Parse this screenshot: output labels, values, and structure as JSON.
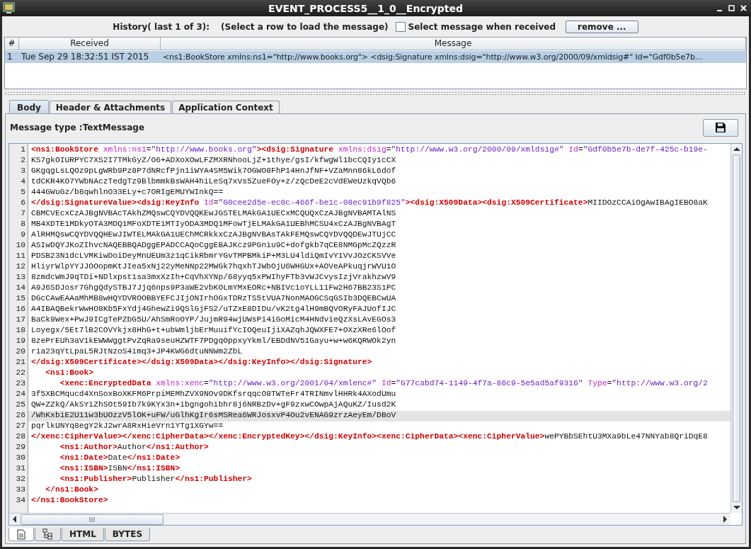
{
  "window": {
    "title": "EVENT_PROCESS5__1_0__Encrypted"
  },
  "history": {
    "label": "History( last 1 of 3):",
    "hint": "(Select a row to load the message)",
    "select_when_received": {
      "label": "Select message when received",
      "checked": false
    },
    "remove_button": "remove ..."
  },
  "history_table": {
    "columns": [
      "#",
      "Received",
      "Message"
    ],
    "rows": [
      {
        "cells": [
          "1",
          "Tue Sep 29 18:32:51 IST 2015",
          "<ns1:BookStore xmlns:ns1=\"http://www.books.org\"> <dsig:Signature xmlns:dsig=\"http://www.w3.org/2000/09/xmldsig#\" Id=\"Gdf0b5e7b..."
        ],
        "selected": true
      }
    ]
  },
  "tabs": [
    {
      "label": "Body",
      "selected": true
    },
    {
      "label": "Header & Attachments",
      "selected": false
    },
    {
      "label": "Application Context",
      "selected": false
    }
  ],
  "message_type": "Message type :TextMessage",
  "editor": {
    "lines": [
      {
        "number": "1",
        "current": false,
        "segments": [
          {
            "kind": "tag",
            "text": "<ns1:BookStore"
          },
          {
            "kind": "attr",
            "text": " xmlns:ns1"
          },
          {
            "kind": "text",
            "text": "="
          },
          {
            "kind": "value",
            "text": "\"http://www.books.org\""
          },
          {
            "kind": "tag",
            "text": "><dsig:Signature"
          },
          {
            "kind": "attr",
            "text": " xmlns:dsig"
          },
          {
            "kind": "text",
            "text": "="
          },
          {
            "kind": "value",
            "text": "\"http://www.w3.org/2000/09/xmldsig#\""
          },
          {
            "kind": "attr",
            "text": " Id"
          },
          {
            "kind": "text",
            "text": "="
          },
          {
            "kind": "value",
            "text": "\"Gdf0b5e7b-de7f-425c-b19e-"
          }
        ]
      },
      {
        "number": "2",
        "current": false,
        "segments": [
          {
            "kind": "text",
            "text": "KS7gkOIURPYC7XS2I7TMkGyZ/O6+ADXoXOwLFZMXRNhooLjZ+1thye/gsI/kfwgWl1bcCQIy1cCX"
          }
        ]
      },
      {
        "number": "3",
        "current": false,
        "segments": [
          {
            "kind": "text",
            "text": "GKgqgLsLQOz9pLgWRb9Pz8P7dNRcfPjn1iWYA4SM5Wik7OGWO8FhP14HnJfNF+VZaMnn86kL6dof"
          }
        ]
      },
      {
        "number": "4",
        "current": false,
        "segments": [
          {
            "kind": "text",
            "text": "tdCKR4KO7YWbNAczTedgTz9BlbmmkBsWAH4hiLeSq7xVs5ZueFOy+z/zQcDeE2cVdEWeUzkqVQb6"
          }
        ]
      },
      {
        "number": "5",
        "current": false,
        "segments": [
          {
            "kind": "text",
            "text": "444GWuGz/b8qwhlnO33ELy+c7ORIgEMUYWInkQ=="
          }
        ]
      },
      {
        "number": "6",
        "current": false,
        "segments": [
          {
            "kind": "tag",
            "text": "</dsig:SignatureValue><dsig:KeyInfo"
          },
          {
            "kind": "attr",
            "text": " Id"
          },
          {
            "kind": "text",
            "text": "="
          },
          {
            "kind": "value",
            "text": "\"G0cee2d5e-ec0c-466f-be1c-08ec91b9f825\""
          },
          {
            "kind": "tag",
            "text": "><dsig:X509Data><dsig:X509Certificate>"
          },
          {
            "kind": "text",
            "text": "MIIDOzCCAiOgAwIBAgIEBO8aK"
          }
        ]
      },
      {
        "number": "7",
        "current": false,
        "segments": [
          {
            "kind": "text",
            "text": "CBMCVEcxCzAJBgNVBAcTAkhZMQswCQYDVQQKEwJGSTELMAkGA1UECxMCQUQxCzAJBgNVBAMTAlNS"
          }
        ]
      },
      {
        "number": "8",
        "current": false,
        "segments": [
          {
            "kind": "text",
            "text": "MB4XDTE1MDkyOTA3MDQ1MFoXDTE1MTIyODA3MDQ1MFowTjELMAkGA1UEBhMCSU4xCzAJBgNVBAgT"
          }
        ]
      },
      {
        "number": "9",
        "current": false,
        "segments": [
          {
            "kind": "text",
            "text": "AlRHMQswCQYDVQQHEwJIWTELMAkGA1UEChMCRkkxCzAJBgNVBAsTAkFEMQswCQYDVQQDEwJTUjCC"
          }
        ]
      },
      {
        "number": "10",
        "current": false,
        "segments": [
          {
            "kind": "text",
            "text": "ASIwDQYJKoZIhvcNAQEBBQADggEPADCCAQoCggEBAJKcz9PGniu9C+dofgkb7qCE8NMGpMcZQzzR"
          }
        ]
      },
      {
        "number": "11",
        "current": false,
        "segments": [
          {
            "kind": "text",
            "text": "PDSB23N1dcLVMKiwDoiDeyMnUEUm3z1qCikRbmrYGvTMPBMkiP+M3LU4ldiQmIvY1VvJOzCKSVVe"
          }
        ]
      },
      {
        "number": "12",
        "current": false,
        "segments": [
          {
            "kind": "text",
            "text": "HliyrWlpYYJJOOopmKtJIea5xNj22yMeNNp22MWGk7hqxhTJWbOjU6WHGUx+AOVeAPkuqjrWVU1O"
          }
        ]
      },
      {
        "number": "13",
        "current": false,
        "segments": [
          {
            "kind": "text",
            "text": "8zmdcWmJ9qTDi+NDlxpst1sa3mxXzIh+CqVhXYNp/68yyq5xPWIhyFTb3vWJCvysIzjVrakhzwV9"
          }
        ]
      },
      {
        "number": "14",
        "current": false,
        "segments": [
          {
            "kind": "text",
            "text": "A9J6SDJosr7GhgQdySTBJ7Jjq6nps9P3aWE2vbKOLmYMxEORc+NBIVc1oYLL11Fw2H67BB23S1PC"
          }
        ]
      },
      {
        "number": "15",
        "current": false,
        "segments": [
          {
            "kind": "text",
            "text": "DGcCAwEAAaMhMB8wHQYDVROOBBYEFCJIjONIrhOGxTDRzTS5tVUA7NonMAOGCSqGSIb3DQEBCwUA"
          }
        ]
      },
      {
        "number": "16",
        "current": false,
        "segments": [
          {
            "kind": "text",
            "text": "A4IBAQBekrWwHO8Kb5FxYdj4GhewZi9QSlGjFS2/uTZxE8DIDu/vK2tg4lH9mBQVORyFAJUofIJC"
          }
        ]
      },
      {
        "number": "17",
        "current": false,
        "segments": [
          {
            "kind": "text",
            "text": "BaCk9Wex+PwJ9ICgTePZbG5U/AhSmRoOYP/JujmR94wjUWsPi4iGoMicM4HNdvieQzXsLAvEGOs3"
          }
        ]
      },
      {
        "number": "18",
        "current": false,
        "segments": [
          {
            "kind": "text",
            "text": "Loyegx/5Et7lB2COVYkjx8HhG+t+ubWmljbErMuuifYcIOQeuIjiXAZqhJQWXFE7+OXzXRe6lOof"
          }
        ]
      },
      {
        "number": "19",
        "current": false,
        "segments": [
          {
            "kind": "text",
            "text": "8zePrEUh3aV1kEWWWggtPvZqRa9seuHZWTF7PDgqOppxyYkml/EBDdNV51Gayu+w+w6KQRWOk2yn"
          }
        ]
      },
      {
        "number": "20",
        "current": false,
        "segments": [
          {
            "kind": "text",
            "text": "ria23qYtLpaL5RJtNzoS4imq3+JP4KWG6dtuNNWm2ZbL"
          }
        ]
      },
      {
        "number": "21",
        "current": false,
        "segments": [
          {
            "kind": "tag",
            "text": "</dsig:X509Certificate></dsig:X509Data></dsig:KeyInfo></dsig:Signature>"
          }
        ]
      },
      {
        "number": "22",
        "current": false,
        "segments": [
          {
            "kind": "tag",
            "text": "   <ns1:Book>"
          }
        ]
      },
      {
        "number": "23",
        "current": false,
        "segments": [
          {
            "kind": "tag",
            "text": "      <xenc:EncryptedData"
          },
          {
            "kind": "attr",
            "text": " xmlns:xenc"
          },
          {
            "kind": "text",
            "text": "="
          },
          {
            "kind": "value",
            "text": "\"http://www.w3.org/2001/04/xmlenc#\""
          },
          {
            "kind": "attr",
            "text": " Id"
          },
          {
            "kind": "text",
            "text": "="
          },
          {
            "kind": "value",
            "text": "\"G77cabd74-1149-4f7a-86c9-5e5ad5af9316\""
          },
          {
            "kind": "attr",
            "text": " Type"
          },
          {
            "kind": "text",
            "text": "="
          },
          {
            "kind": "value",
            "text": "\"http://www.w3.org/2"
          }
        ]
      },
      {
        "number": "24",
        "current": false,
        "segments": [
          {
            "kind": "text",
            "text": "3f5XBCMqucd4XnSoxBoXKFM6PrpiMEMhZVX9NOv9DKfsrqqcO8TWTeFr4TRINmvlHHRk4AXodUmu"
          }
        ]
      },
      {
        "number": "25",
        "current": false,
        "segments": [
          {
            "kind": "text",
            "text": "QW+ZZkQ/AkSYiZhSOt59Ib7k9KYx3n+ibgngohibhr8j6NRBzDv+gF9zxwCOwpAjAQuKZ/Iusd2K"
          }
        ]
      },
      {
        "number": "26",
        "current": true,
        "segments": [
          {
            "kind": "text",
            "text": "/WhKxbiE2U11w3bUOzzV5lOK+uFW/uGlhKgIr6sMSRea6WRJosxvP4Ou2vENAG9zrzAeyEm/DBoV"
          }
        ]
      },
      {
        "number": "27",
        "current": false,
        "segments": [
          {
            "kind": "text",
            "text": "pqrlkUNYq8egY2kJ2wrA8RxHieVrn1YTg1XGYw=="
          }
        ]
      },
      {
        "number": "28",
        "current": false,
        "segments": [
          {
            "kind": "tag",
            "text": "</xenc:CipherValue></xenc:CipherData></xenc:EncryptedKey></dsig:KeyInfo><xenc:CipherData><xenc:CipherValue>"
          },
          {
            "kind": "text",
            "text": "wePYBbSEhtU3MXa9bLe47NNYab8QriDqE8"
          }
        ]
      },
      {
        "number": "29",
        "current": false,
        "segments": [
          {
            "kind": "tag",
            "text": "      <ns1:Author>"
          },
          {
            "kind": "text",
            "text": "Author"
          },
          {
            "kind": "tag",
            "text": "</ns1:Author>"
          }
        ]
      },
      {
        "number": "30",
        "current": false,
        "segments": [
          {
            "kind": "tag",
            "text": "      <ns1:Date>"
          },
          {
            "kind": "text",
            "text": "Date"
          },
          {
            "kind": "tag",
            "text": "</ns1:Date>"
          }
        ]
      },
      {
        "number": "31",
        "current": false,
        "segments": [
          {
            "kind": "tag",
            "text": "      <ns1:ISBN>"
          },
          {
            "kind": "text",
            "text": "ISBN"
          },
          {
            "kind": "tag",
            "text": "</ns1:ISBN>"
          }
        ]
      },
      {
        "number": "32",
        "current": false,
        "segments": [
          {
            "kind": "tag",
            "text": "      <ns1:Publisher>"
          },
          {
            "kind": "text",
            "text": "Publisher"
          },
          {
            "kind": "tag",
            "text": "</ns1:Publisher>"
          }
        ]
      },
      {
        "number": "33",
        "current": false,
        "segments": [
          {
            "kind": "tag",
            "text": "   </ns1:Book>"
          }
        ]
      },
      {
        "number": "34",
        "current": false,
        "segments": [
          {
            "kind": "tag",
            "text": "</ns1:BookStore>"
          }
        ]
      }
    ]
  },
  "view_tabs": [
    {
      "kind": "document",
      "selected": true
    },
    {
      "kind": "tree",
      "selected": false
    },
    {
      "kind": "text",
      "label": "HTML",
      "selected": false
    },
    {
      "kind": "text",
      "label": "BYTES",
      "selected": false
    }
  ]
}
